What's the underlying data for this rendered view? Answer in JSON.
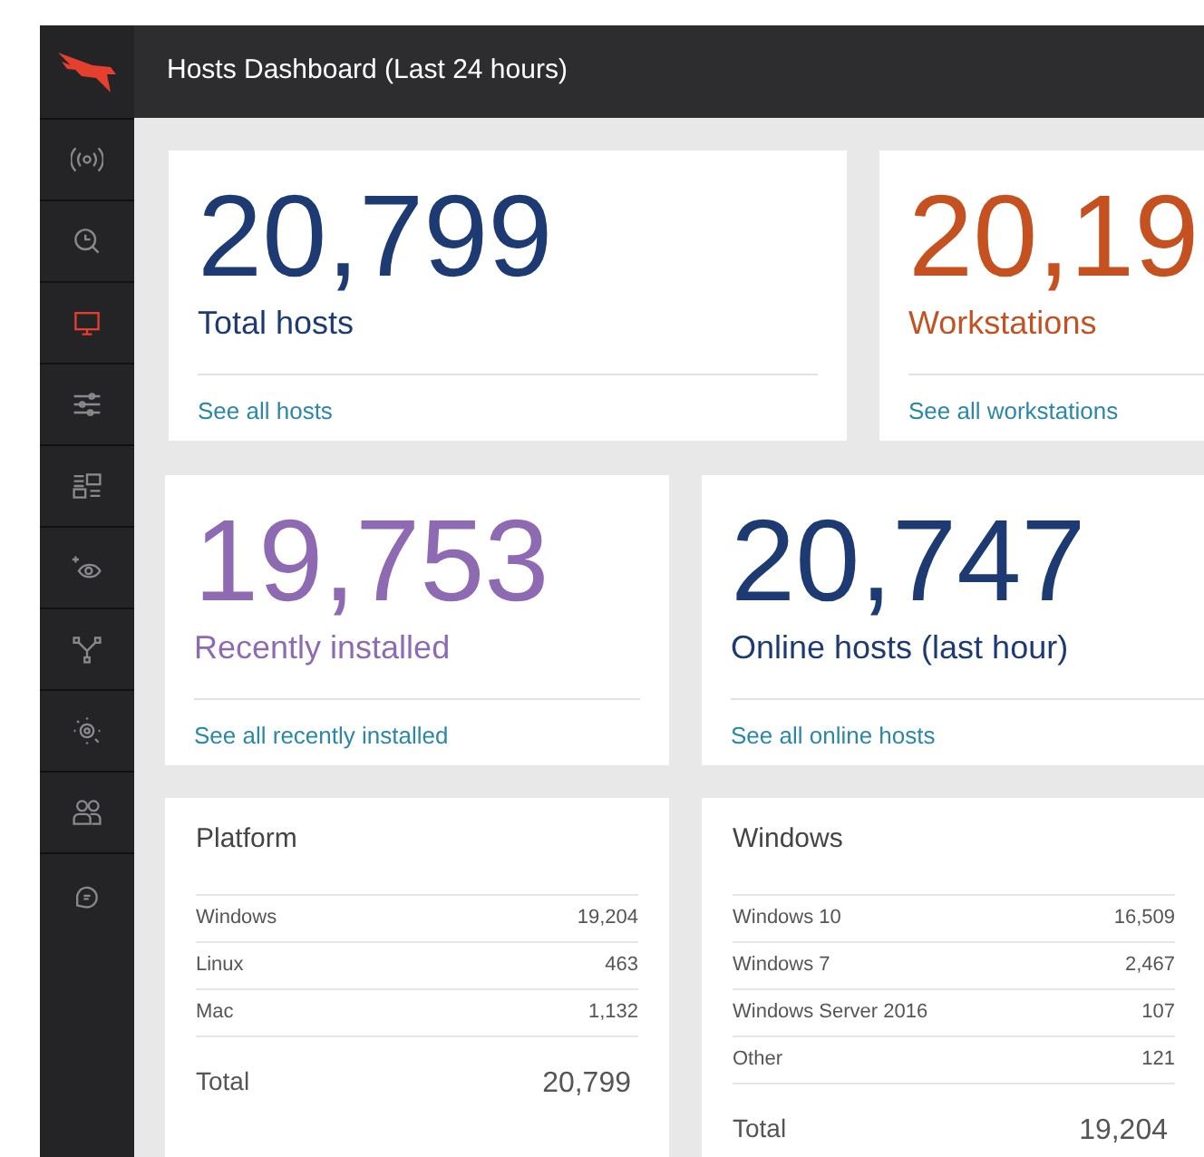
{
  "header": {
    "title": "Hosts Dashboard (Last 24 hours)"
  },
  "sidebar": {
    "items": [
      {
        "selected": false
      },
      {
        "selected": false
      },
      {
        "selected": true
      },
      {
        "selected": false
      },
      {
        "selected": false
      },
      {
        "selected": false
      },
      {
        "selected": false
      },
      {
        "selected": false
      },
      {
        "selected": false
      },
      {
        "selected": false
      }
    ]
  },
  "stat_cards": [
    {
      "value": "20,799",
      "label": "Total hosts",
      "link": "See all hosts",
      "color": "#1d3b72"
    },
    {
      "value": "20,19",
      "label": "Workstations",
      "link": "See all workstations",
      "color": "#c4511f"
    },
    {
      "value": "19,753",
      "label": "Recently installed",
      "link": "See all recently installed",
      "color": "#8e6ab3"
    },
    {
      "value": "20,747",
      "label": "Online hosts (last hour)",
      "link": "See all online hosts",
      "color": "#1d3b72"
    }
  ],
  "tables": [
    {
      "title": "Platform",
      "rows": [
        {
          "name": "Windows",
          "count": "19,204"
        },
        {
          "name": "Linux",
          "count": "463"
        },
        {
          "name": "Mac",
          "count": "1,132"
        }
      ],
      "total_label": "Total",
      "total": "20,799"
    },
    {
      "title": "Windows",
      "rows": [
        {
          "name": "Windows 10",
          "count": "16,509"
        },
        {
          "name": "Windows 7",
          "count": "2,467"
        },
        {
          "name": "Windows Server 2016",
          "count": "107"
        },
        {
          "name": "Other",
          "count": "121"
        }
      ],
      "total_label": "Total",
      "total": "19,204"
    }
  ]
}
